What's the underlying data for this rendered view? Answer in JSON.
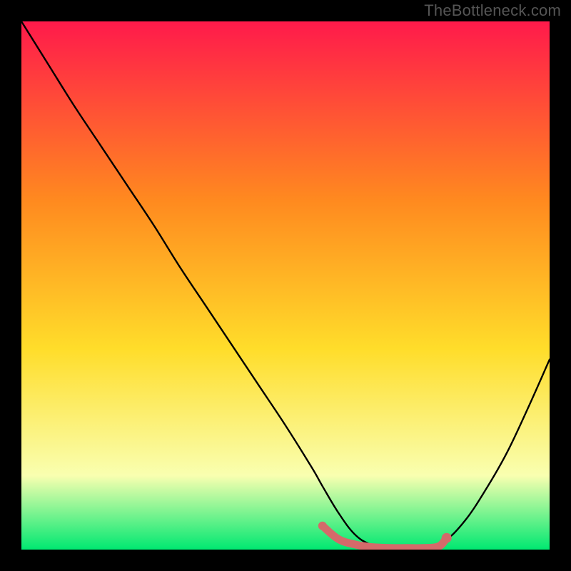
{
  "watermark": "TheBottleneck.com",
  "colors": {
    "page_bg": "#000000",
    "gradient_top": "#ff1a4b",
    "gradient_mid1": "#ff8a1f",
    "gradient_mid2": "#ffdd2a",
    "gradient_mid3": "#f9ffb0",
    "gradient_bottom": "#00e871",
    "curve": "#000000",
    "highlight": "#d46a6a"
  },
  "chart_data": {
    "type": "line",
    "title": "",
    "xlabel": "",
    "ylabel": "",
    "xlim": [
      0,
      100
    ],
    "ylim": [
      0,
      100
    ],
    "series": [
      {
        "name": "bottleneck-curve",
        "x": [
          0,
          5,
          10,
          15,
          20,
          25,
          30,
          35,
          40,
          45,
          50,
          55,
          57,
          60,
          63,
          66,
          70,
          73,
          76,
          80,
          84,
          88,
          92,
          96,
          100
        ],
        "y": [
          100,
          92,
          84,
          76.5,
          69,
          61.5,
          53.5,
          46,
          38.5,
          31,
          23.5,
          15.5,
          12,
          7,
          3,
          1,
          0,
          0,
          0,
          1.5,
          5.5,
          11.5,
          18.5,
          27,
          36
        ]
      },
      {
        "name": "optimal-range",
        "x": [
          57,
          60,
          63,
          66,
          70,
          73,
          76,
          79,
          80.5
        ],
        "y": [
          4.5,
          2,
          1,
          0.5,
          0.3,
          0.3,
          0.3,
          0.6,
          2.2
        ]
      }
    ],
    "annotations": [
      {
        "name": "optimal-start-dot",
        "x": 57,
        "y": 4.5
      },
      {
        "name": "optimal-end-dot",
        "x": 80.5,
        "y": 2.2
      }
    ]
  }
}
